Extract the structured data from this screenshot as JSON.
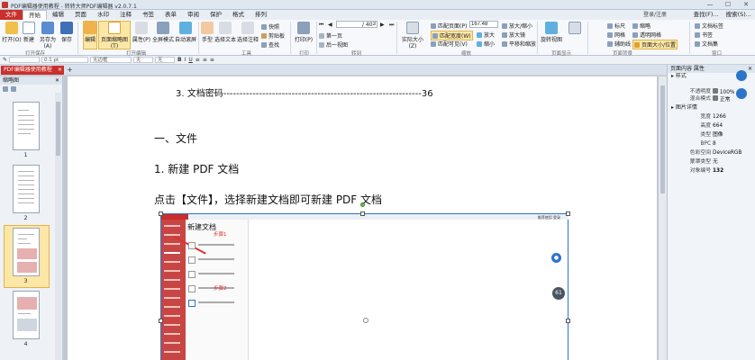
{
  "window": {
    "title": "PDF编辑器使用教程 - 转转大师PDF编辑器 v2.0.7.1",
    "controls": [
      "—",
      "☐",
      "✕"
    ]
  },
  "menu": {
    "items": [
      "文件",
      "开始",
      "编辑",
      "页面",
      "水印",
      "注释",
      "书签",
      "表单",
      "审阅",
      "保护",
      "格式",
      "排列"
    ],
    "login": "登录/注册",
    "right": [
      "查找(F)...",
      "搜索(S)..."
    ]
  },
  "ribbon": {
    "open": "打开(O)",
    "new": "新建",
    "save_as": "另存为(A)",
    "save": "保存",
    "group_open_save": "打开保存",
    "edit": "编辑",
    "page_thumb": "页面缩略图(T)",
    "properties": "属性(P)",
    "fullscreen": "全屏模式",
    "autoscroll": "自动滚屏",
    "group_view_edit": "打开编辑",
    "hand": "手型",
    "select_text": "选择文本",
    "select_annot": "选择注释",
    "snapshot": "快照",
    "clipboard": "剪贴板",
    "find": "查找",
    "group_tools": "工具",
    "print": "打印(P)",
    "group_print": "打印",
    "first_page": "第一页",
    "prev_page": "上一页",
    "next_page": "下一页",
    "last_page": "后一视图",
    "page_current": "3",
    "page_total": "/ 40",
    "group_nav": "转到",
    "actual_size": "实际大小(Z)",
    "fit_page": "匹配页面(P)",
    "fit_width": "匹配宽度(W)",
    "fit_visible": "匹配可见(V)",
    "zoom_value": "167.48",
    "zoom_in": "放大",
    "zoom_out": "缩小",
    "zoom_in_out": "放大/缩小",
    "magnifier": "放大镜",
    "pan_zoom": "平移和缩放",
    "group_zoom": "缩放",
    "rotate": "旋转视图",
    "group_page_display": "页面显示",
    "ruler": "标尺",
    "grid": "网格",
    "guides": "辅助线",
    "thumbs": "缩略",
    "transparent": "透明网格",
    "page_size_pos": "页面大小/位置",
    "group_page_background": "页面背景",
    "doc_tag": "文档标签",
    "bookmarks": "书签",
    "doc_panel": "文档集",
    "group_window": "窗口"
  },
  "formatbar": {
    "font_size": "0.1 pt",
    "line_style": "无边框",
    "fill_none": "无",
    "width_none": "无"
  },
  "tab": {
    "label": "PDF编辑器使用教程"
  },
  "thumbnails": {
    "title": "缩略图",
    "pages": [
      "1",
      "2",
      "3",
      "4"
    ]
  },
  "document": {
    "toc_line": "3. 文档密码-------------------------------------------------------------36",
    "heading1": "一、文件",
    "heading2": "1. 新建 PDF 文档",
    "instruction": "点击【文件】，选择新建文档即可新建 PDF 文档",
    "shot_title": "新建文档",
    "step1": "步骤1",
    "step2": "步骤2",
    "shot_toolbar": "推荐使用  登录"
  },
  "properties": {
    "title": "页面内容 属性",
    "style_section": "样式",
    "opacity_label": "不透明度",
    "opacity_value": "100%",
    "blend_label": "混合模式",
    "blend_value": "正常",
    "image_section": "图片详情",
    "width_label": "宽度",
    "width_value": "1266",
    "height_label": "高度",
    "height_value": "664",
    "type_label": "类型",
    "type_value": "图像",
    "bpc_label": "BPC",
    "bpc_value": "8",
    "colorspace_label": "色彩空间",
    "colorspace_value": "DeviceRGB",
    "mask_label": "蒙罩类型",
    "mask_value": "无",
    "objnum_label": "对象编号",
    "objnum_value": "132"
  },
  "floating": {
    "badge": "61"
  },
  "colors": {
    "accent": "#c9302c",
    "selection": "#fde7a6",
    "blue": "#2c74c9"
  }
}
